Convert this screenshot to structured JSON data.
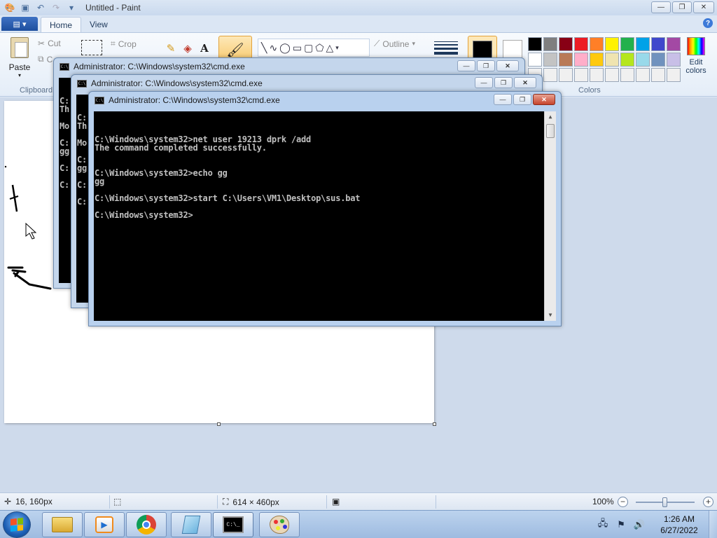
{
  "paint": {
    "title": "Untitled - Paint",
    "tabs": [
      "Home",
      "View"
    ],
    "clipboard": {
      "paste": "Paste",
      "cut": "Cut",
      "copy": "C",
      "group": "Clipboard"
    },
    "image": {
      "crop": "Crop"
    },
    "shapes": {
      "outline": "Outline"
    },
    "colors": {
      "group": "Colors",
      "edit_colors_line1": "Edit",
      "edit_colors_line2": "colors",
      "palette": [
        "#000000",
        "#7f7f7f",
        "#880015",
        "#ed1c24",
        "#ff7f27",
        "#fff200",
        "#22b14c",
        "#00a2e8",
        "#3f48cc",
        "#a349a4",
        "#ffffff",
        "#c3c3c3",
        "#b97a57",
        "#ffaec9",
        "#ffc90e",
        "#efe4b0",
        "#b5e61d",
        "#99d9ea",
        "#7092be",
        "#c8bfe7",
        "#f0f0f0",
        "#f0f0f0",
        "#f0f0f0",
        "#f0f0f0",
        "#f0f0f0",
        "#f0f0f0",
        "#f0f0f0",
        "#f0f0f0",
        "#f0f0f0",
        "#f0f0f0"
      ]
    },
    "status": {
      "cursor_pos": "16, 160px",
      "canvas_size": "614 × 460px",
      "zoom": "100%"
    }
  },
  "cmd_windows": [
    {
      "title": "Administrator: C:\\Windows\\system32\\cmd.exe",
      "lines": [
        "C:",
        "Th",
        "",
        "Mo",
        "",
        "C:",
        "gg",
        "",
        "C:",
        "",
        "C:"
      ]
    },
    {
      "title": "Administrator: C:\\Windows\\system32\\cmd.exe",
      "lines": [
        "C:",
        "Th",
        "",
        "Mo",
        "",
        "C:",
        "gg",
        "",
        "C:",
        "",
        "C:"
      ]
    },
    {
      "title": "Administrator: C:\\Windows\\system32\\cmd.exe",
      "lines": [
        "C:\\Windows\\system32>net user 19213 dprk /add",
        "The command completed successfully.",
        "",
        "",
        "C:\\Windows\\system32>echo gg",
        "gg",
        "",
        "C:\\Windows\\system32>start C:\\Users\\VM1\\Desktop\\sus.bat",
        "",
        "C:\\Windows\\system32>"
      ]
    }
  ],
  "taskbar": {
    "clock_time": "1:26 AM",
    "clock_date": "6/27/2022"
  },
  "icons": {
    "paint_app": "paint-icon",
    "save": "save-icon",
    "undo": "undo-icon",
    "redo": "redo-icon",
    "cmd": "cmd-icon",
    "start": "windows-flag-icon"
  }
}
